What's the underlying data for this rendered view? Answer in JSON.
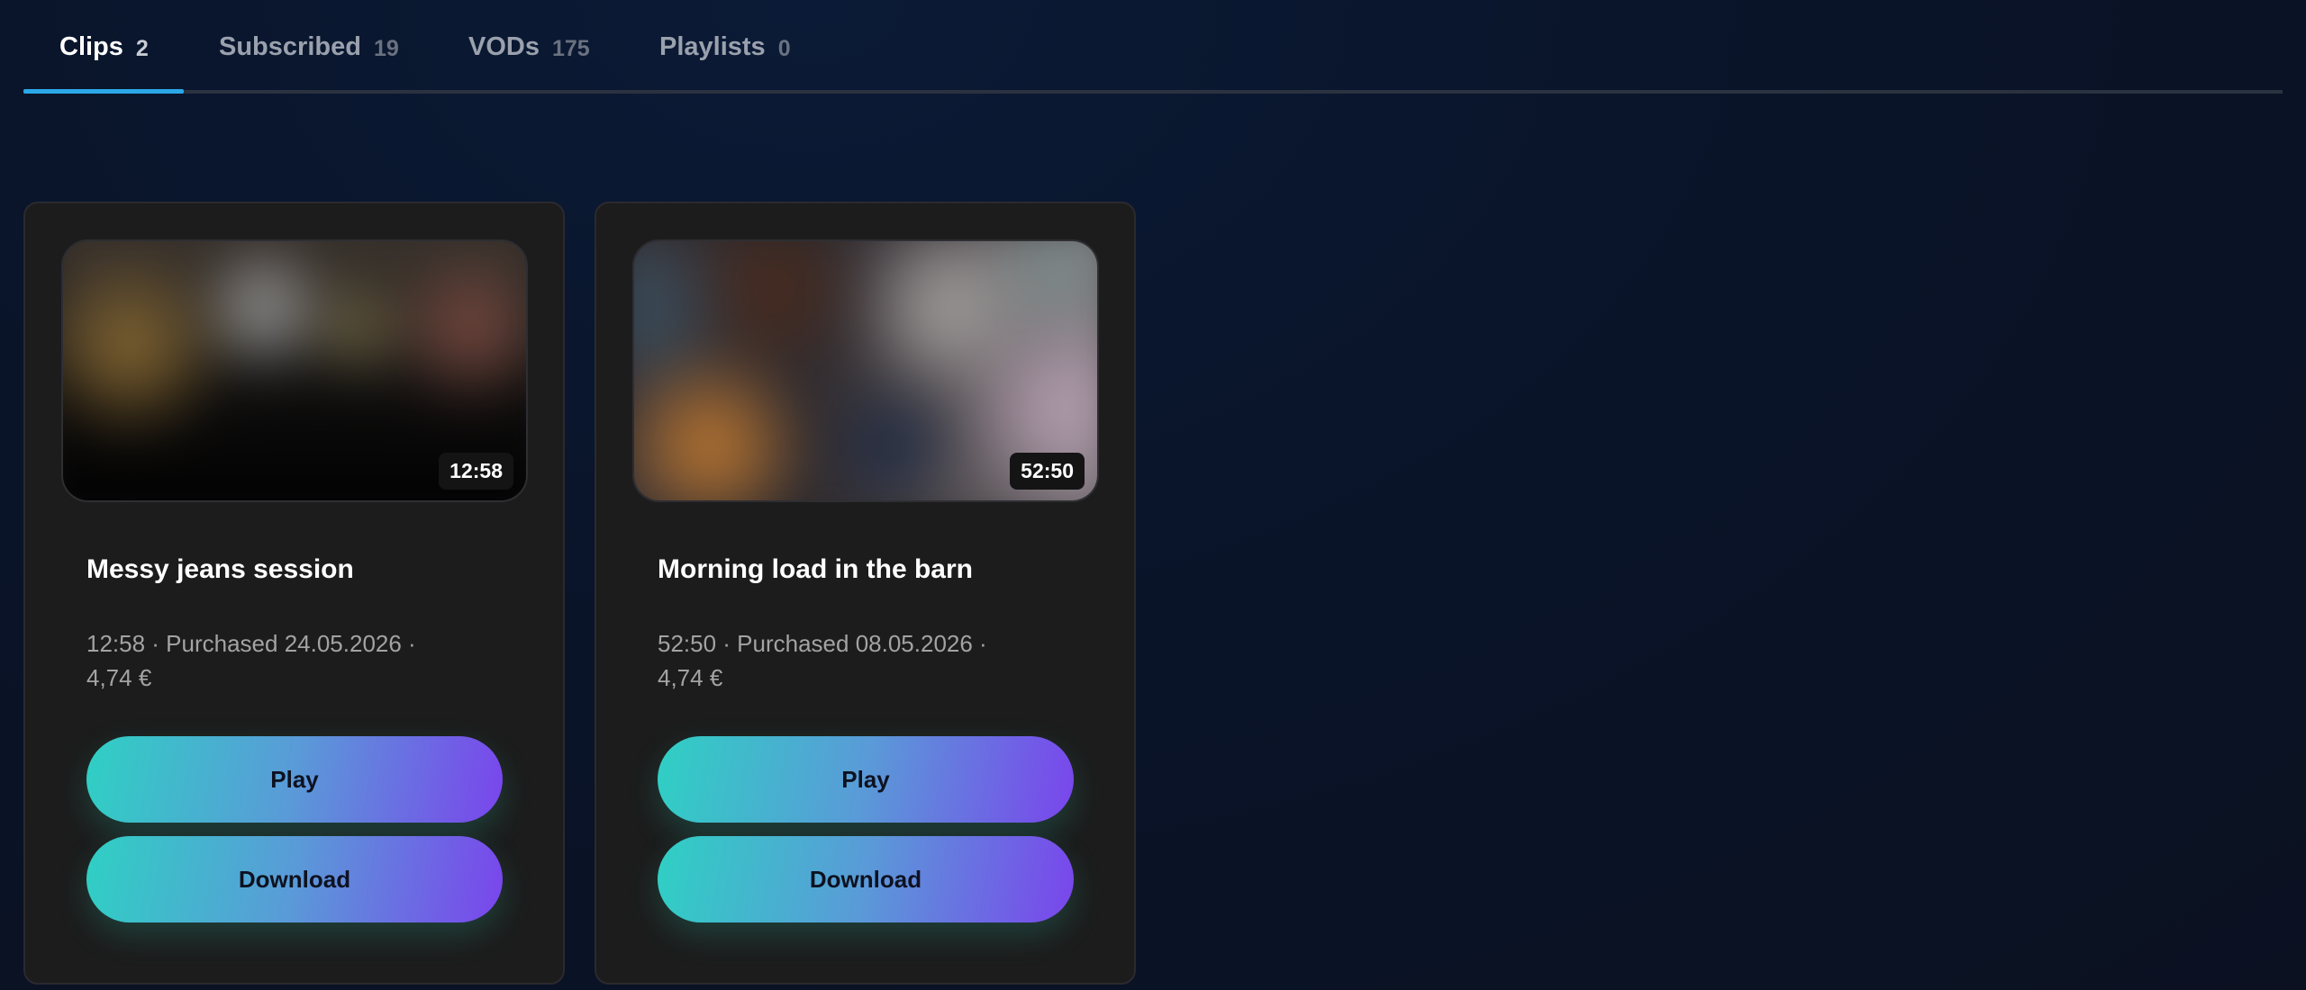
{
  "tabs": [
    {
      "label": "Clips",
      "count": "2",
      "active": true
    },
    {
      "label": "Subscribed",
      "count": "19",
      "active": false
    },
    {
      "label": "VODs",
      "count": "175",
      "active": false
    },
    {
      "label": "Playlists",
      "count": "0",
      "active": false
    }
  ],
  "colors": {
    "accent_underline": "#2ba8e8",
    "button_gradient_start": "#2fd0c4",
    "button_gradient_end": "#7a45ec",
    "card_background": "#1c1c1c"
  },
  "clips": [
    {
      "title": "Messy jeans session",
      "duration": "12:58",
      "meta_line1": "12:58 · Purchased 24.05.2026 ·",
      "meta_line2": "4,74 €",
      "play_label": "Play",
      "download_label": "Download"
    },
    {
      "title": "Morning load in the barn",
      "duration": "52:50",
      "meta_line1": "52:50 · Purchased 08.05.2026 ·",
      "meta_line2": "4,74 €",
      "play_label": "Play",
      "download_label": "Download"
    }
  ]
}
